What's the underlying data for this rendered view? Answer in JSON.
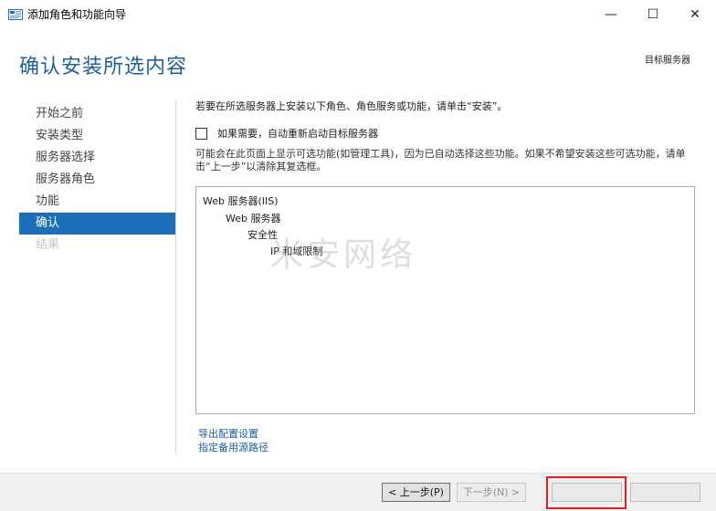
{
  "window": {
    "title": "添加角色和功能向导",
    "minimize_glyph": "—",
    "maximize_glyph": "☐",
    "close_glyph": "✕"
  },
  "header": {
    "page_title": "确认安装所选内容",
    "destination_server_label": "目标服务器"
  },
  "nav": {
    "items": [
      {
        "label": "开始之前",
        "state": "normal"
      },
      {
        "label": "安装类型",
        "state": "normal"
      },
      {
        "label": "服务器选择",
        "state": "normal"
      },
      {
        "label": "服务器角色",
        "state": "normal"
      },
      {
        "label": "功能",
        "state": "normal"
      },
      {
        "label": "确认",
        "state": "active"
      },
      {
        "label": "结果",
        "state": "disabled"
      }
    ]
  },
  "content": {
    "intro": "若要在所选服务器上安装以下角色、角色服务或功能，请单击“安装”。",
    "restart_checkbox_label": "如果需要，自动重新启动目标服务器",
    "restart_checked": false,
    "note": "可能会在此页面上显示可选功能(如管理工具)，因为已自动选择这些功能。如果不希望安装这些可选功能，请单击“上一步”以清除其复选框。"
  },
  "features": {
    "items": [
      {
        "label": "Web 服务器(IIS)",
        "level": 0
      },
      {
        "label": "Web 服务器",
        "level": 1
      },
      {
        "label": "安全性",
        "level": 2
      },
      {
        "label": "IP 和域限制",
        "level": 3
      }
    ]
  },
  "watermark": "米安网络",
  "links": {
    "export": "导出配置设置",
    "alternate_source": "指定备用源路径"
  },
  "footer": {
    "previous_label": "< 上一步(P)",
    "next_label": "下一步(N) >",
    "install_label": "",
    "cancel_label": ""
  },
  "colors": {
    "accent": "#1a6fb8",
    "title": "#1f5f9e",
    "link": "#1a5fa8",
    "highlight": "#e02020"
  }
}
